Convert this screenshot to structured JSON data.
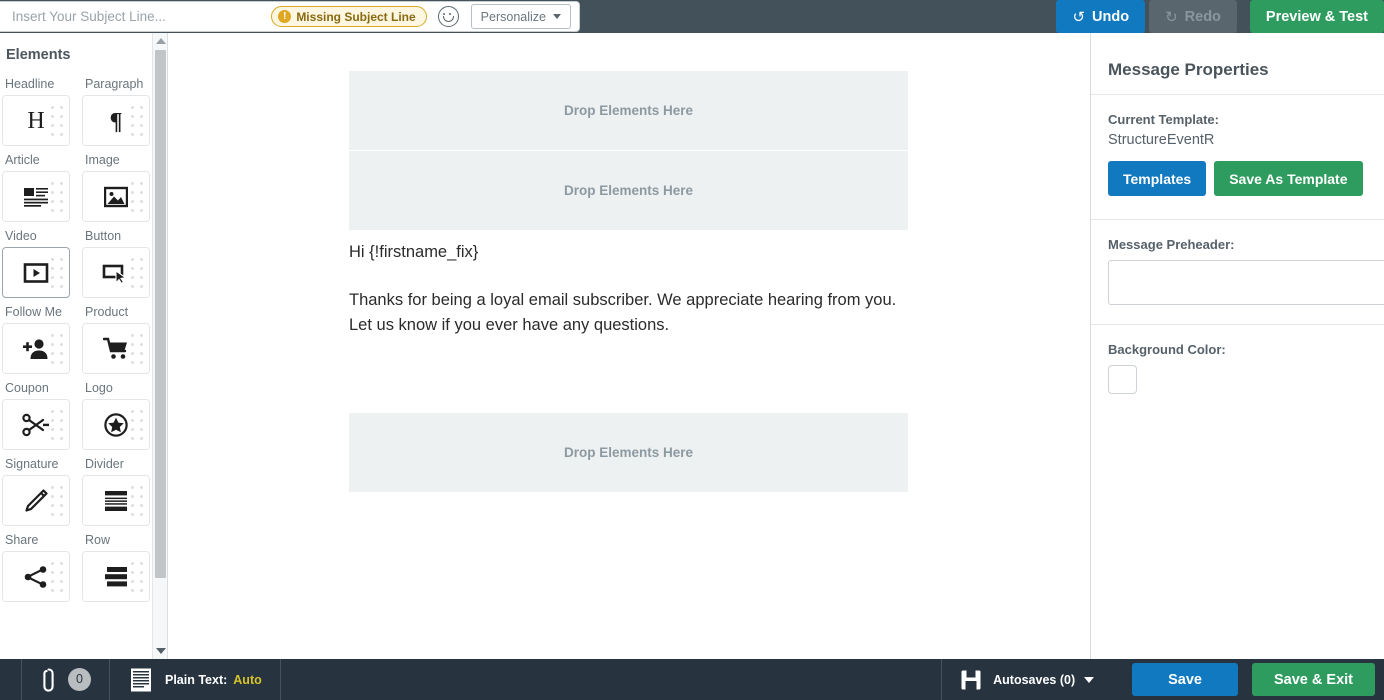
{
  "header": {
    "subject_placeholder": "Insert Your Subject Line...",
    "subject_value": "",
    "missing_subject_badge": "Missing Subject Line",
    "warn_glyph": "!",
    "emoji_icon": "emoji-smiley-icon",
    "personalize_label": "Personalize",
    "undo_label": "Undo",
    "undo_icon": "↺",
    "redo_label": "Redo",
    "redo_icon": "↻",
    "preview_label": "Preview & Test",
    "accent_blue": "#1179bf",
    "accent_green": "#2f9c5f",
    "bar_bg": "#43515a",
    "badge_border": "#d9a825"
  },
  "sidebar": {
    "title": "Elements",
    "items": [
      {
        "label": "Headline",
        "icon": "headline-h-icon",
        "active": false
      },
      {
        "label": "Paragraph",
        "icon": "paragraph-pilcrow-icon",
        "active": false
      },
      {
        "label": "Article",
        "icon": "article-icon",
        "active": false
      },
      {
        "label": "Image",
        "icon": "image-icon",
        "active": false
      },
      {
        "label": "Video",
        "icon": "video-play-icon",
        "active": true
      },
      {
        "label": "Button",
        "icon": "button-cursor-icon",
        "active": false
      },
      {
        "label": "Follow Me",
        "icon": "follow-me-person-plus-icon",
        "active": false
      },
      {
        "label": "Product",
        "icon": "product-cart-icon",
        "active": false
      },
      {
        "label": "Coupon",
        "icon": "coupon-scissors-icon",
        "active": false
      },
      {
        "label": "Logo",
        "icon": "logo-star-circle-icon",
        "active": false
      },
      {
        "label": "Signature",
        "icon": "signature-pen-icon",
        "active": false
      },
      {
        "label": "Divider",
        "icon": "divider-icon",
        "active": false
      },
      {
        "label": "Share",
        "icon": "share-nodes-icon",
        "active": false
      },
      {
        "label": "Row",
        "icon": "row-layout-icon",
        "active": false
      }
    ],
    "scroll_up_icon": "scroll-up-arrow-icon",
    "scroll_down_icon": "scroll-down-arrow-icon"
  },
  "canvas": {
    "dropzone_label": "Drop Elements Here",
    "greeting": "Hi {!firstname_fix}",
    "body_paragraph": "Thanks for being a loyal email subscriber. We appreciate hearing from you. Let us know if you ever have any questions."
  },
  "properties": {
    "title": "Message Properties",
    "current_template_label": "Current Template:",
    "current_template_value": "StructureEventR",
    "templates_button": "Templates",
    "save_as_template_button": "Save As Template",
    "preheader_label": "Message Preheader:",
    "preheader_value": "",
    "preheader_placeholder": "",
    "background_color_label": "Background Color:",
    "background_color_value": "#ffffff"
  },
  "statusbar": {
    "attachment_icon": "paperclip-icon",
    "attachment_count": "0",
    "plain_text_icon": "plain-text-lines-icon",
    "plain_text_label": "Plain Text:",
    "plain_text_value": "Auto",
    "autosave_icon": "floppy-disk-icon",
    "autosaves_label": "Autosaves (0)",
    "save_label": "Save",
    "save_exit_label": "Save & Exit",
    "bar_bg": "#273440"
  }
}
